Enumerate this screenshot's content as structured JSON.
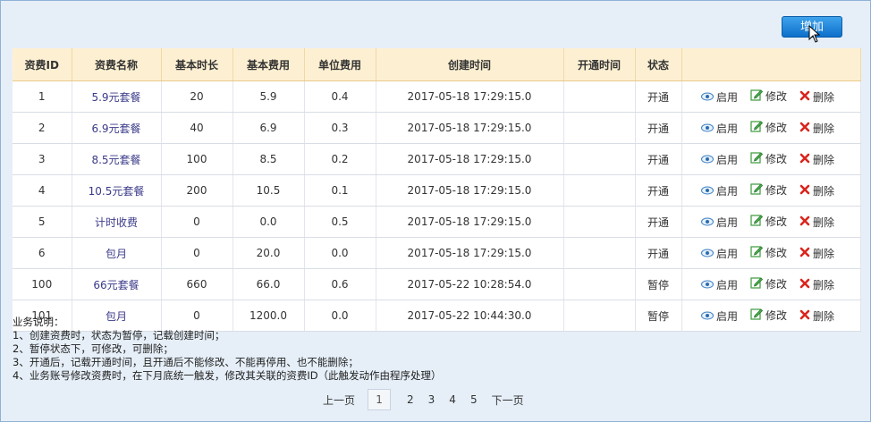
{
  "toolbar": {
    "add_label": "增加"
  },
  "table": {
    "headers": [
      "资费ID",
      "资费名称",
      "基本时长",
      "基本费用",
      "单位费用",
      "创建时间",
      "开通时间",
      "状态",
      ""
    ],
    "rows": [
      {
        "id": "1",
        "name": "5.9元套餐",
        "duration": "20",
        "base_fee": "5.9",
        "unit_fee": "0.4",
        "created": "2017-05-18 17:29:15.0",
        "opened": "",
        "status": "开通"
      },
      {
        "id": "2",
        "name": "6.9元套餐",
        "duration": "40",
        "base_fee": "6.9",
        "unit_fee": "0.3",
        "created": "2017-05-18 17:29:15.0",
        "opened": "",
        "status": "开通"
      },
      {
        "id": "3",
        "name": "8.5元套餐",
        "duration": "100",
        "base_fee": "8.5",
        "unit_fee": "0.2",
        "created": "2017-05-18 17:29:15.0",
        "opened": "",
        "status": "开通"
      },
      {
        "id": "4",
        "name": "10.5元套餐",
        "duration": "200",
        "base_fee": "10.5",
        "unit_fee": "0.1",
        "created": "2017-05-18 17:29:15.0",
        "opened": "",
        "status": "开通"
      },
      {
        "id": "5",
        "name": "计时收费",
        "duration": "0",
        "base_fee": "0.0",
        "unit_fee": "0.5",
        "created": "2017-05-18 17:29:15.0",
        "opened": "",
        "status": "开通"
      },
      {
        "id": "6",
        "name": "包月",
        "duration": "0",
        "base_fee": "20.0",
        "unit_fee": "0.0",
        "created": "2017-05-18 17:29:15.0",
        "opened": "",
        "status": "开通"
      },
      {
        "id": "100",
        "name": "66元套餐",
        "duration": "660",
        "base_fee": "66.0",
        "unit_fee": "0.6",
        "created": "2017-05-22 10:28:54.0",
        "opened": "",
        "status": "暂停"
      },
      {
        "id": "101",
        "name": "包月",
        "duration": "0",
        "base_fee": "1200.0",
        "unit_fee": "0.0",
        "created": "2017-05-22 10:44:30.0",
        "opened": "",
        "status": "暂停"
      }
    ],
    "actions": {
      "enable": "启用",
      "edit": "修改",
      "delete": "删除"
    }
  },
  "notes": {
    "title": "业务说明：",
    "lines": [
      "1、创建资费时，状态为暂停，记载创建时间；",
      "2、暂停状态下，可修改，可删除；",
      "3、开通后，记载开通时间，且开通后不能修改、不能再停用、也不能删除；",
      "4、业务账号修改资费时，在下月底统一触发，修改其关联的资费ID（此触发动作由程序处理）"
    ]
  },
  "pager": {
    "prev": "上一页",
    "current": "1",
    "pages": [
      "2",
      "3",
      "4",
      "5"
    ],
    "next": "下一页"
  },
  "colors": {
    "header_bg": "#fdf0d2",
    "button_blue": "#1a7fd6",
    "delete_red": "#d9251d",
    "edit_green": "#3a9a3a"
  },
  "icons": {
    "enable": "eye-icon",
    "edit": "pencil-icon",
    "delete": "x-icon"
  }
}
